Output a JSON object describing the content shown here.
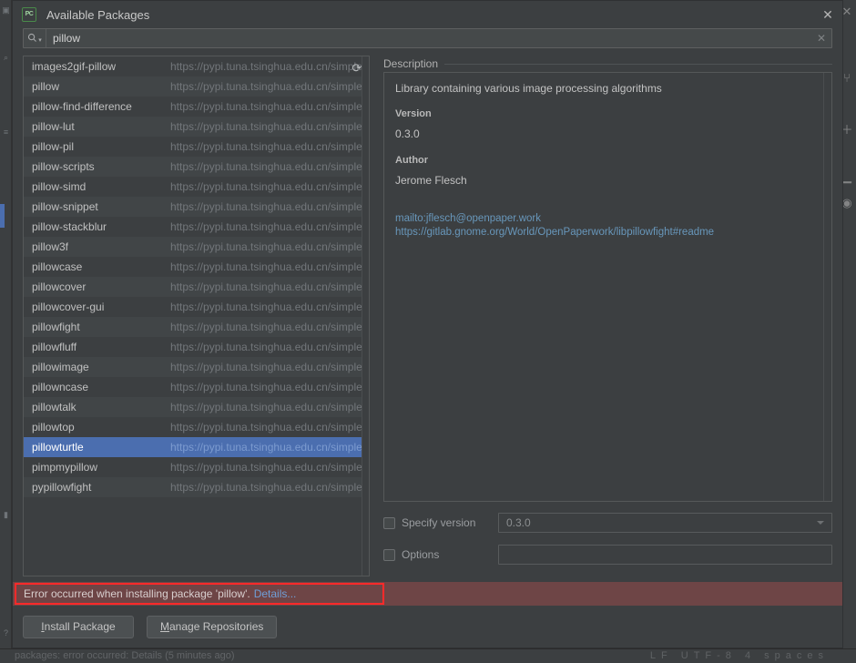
{
  "window": {
    "title": "Available Packages",
    "app_icon": "PC",
    "close_icon": "✕"
  },
  "search": {
    "icon": "search-icon",
    "value": "pillow",
    "placeholder": "",
    "clear_icon": "✕"
  },
  "package_list": {
    "refresh_icon": "⟳",
    "repo_url": "https://pypi.tuna.tsinghua.edu.cn/simple/",
    "selected_index": 19,
    "items": [
      {
        "name": "images2gif-pillow",
        "url": "https://pypi.tuna.tsinghua.edu.cn/simple/"
      },
      {
        "name": "pillow",
        "url": "https://pypi.tuna.tsinghua.edu.cn/simple/"
      },
      {
        "name": "pillow-find-difference",
        "url": "https://pypi.tuna.tsinghua.edu.cn/simple/"
      },
      {
        "name": "pillow-lut",
        "url": "https://pypi.tuna.tsinghua.edu.cn/simple/"
      },
      {
        "name": "pillow-pil",
        "url": "https://pypi.tuna.tsinghua.edu.cn/simple/"
      },
      {
        "name": "pillow-scripts",
        "url": "https://pypi.tuna.tsinghua.edu.cn/simple/"
      },
      {
        "name": "pillow-simd",
        "url": "https://pypi.tuna.tsinghua.edu.cn/simple/"
      },
      {
        "name": "pillow-snippet",
        "url": "https://pypi.tuna.tsinghua.edu.cn/simple/"
      },
      {
        "name": "pillow-stackblur",
        "url": "https://pypi.tuna.tsinghua.edu.cn/simple/"
      },
      {
        "name": "pillow3f",
        "url": "https://pypi.tuna.tsinghua.edu.cn/simple/"
      },
      {
        "name": "pillowcase",
        "url": "https://pypi.tuna.tsinghua.edu.cn/simple/"
      },
      {
        "name": "pillowcover",
        "url": "https://pypi.tuna.tsinghua.edu.cn/simple/"
      },
      {
        "name": "pillowcover-gui",
        "url": "https://pypi.tuna.tsinghua.edu.cn/simple/"
      },
      {
        "name": "pillowfight",
        "url": "https://pypi.tuna.tsinghua.edu.cn/simple/"
      },
      {
        "name": "pillowfluff",
        "url": "https://pypi.tuna.tsinghua.edu.cn/simple/"
      },
      {
        "name": "pillowimage",
        "url": "https://pypi.tuna.tsinghua.edu.cn/simple/"
      },
      {
        "name": "pillowncase",
        "url": "https://pypi.tuna.tsinghua.edu.cn/simple/"
      },
      {
        "name": "pillowtalk",
        "url": "https://pypi.tuna.tsinghua.edu.cn/simple/"
      },
      {
        "name": "pillowtop",
        "url": "https://pypi.tuna.tsinghua.edu.cn/simple/"
      },
      {
        "name": "pillowturtle",
        "url": "https://pypi.tuna.tsinghua.edu.cn/simple/"
      },
      {
        "name": "pimpmypillow",
        "url": "https://pypi.tuna.tsinghua.edu.cn/simple/"
      },
      {
        "name": "pypillowfight",
        "url": "https://pypi.tuna.tsinghua.edu.cn/simple/"
      }
    ]
  },
  "description": {
    "legend": "Description",
    "summary": "Library containing various image processing algorithms",
    "version_label": "Version",
    "version_value": "0.3.0",
    "author_label": "Author",
    "author_value": "Jerome Flesch",
    "links": [
      "mailto:jflesch@openpaper.work",
      "https://gitlab.gnome.org/World/OpenPaperwork/libpillowfight#readme"
    ]
  },
  "options": {
    "specify_version_label": "Specify version",
    "specify_version_value": "0.3.0",
    "specify_version_checked": false,
    "options_label": "Options",
    "options_value": "",
    "options_checked": false,
    "dropdown_icon": "chevron-down-icon"
  },
  "error": {
    "message": "Error occurred when installing package 'pillow'.",
    "details_link": "Details...",
    "highlight_color": "#ff2a2a",
    "bar_color": "#6e4546"
  },
  "footer": {
    "install_mnemonic": "I",
    "install_rest": "nstall Package",
    "manage_mnemonic": "M",
    "manage_rest": "anage Repositories"
  },
  "ide": {
    "status_text": "packages: error occurred: Details (5 minutes ago)",
    "status_right": "LF    UTF-8    4 spaces",
    "right_icons": [
      "close-icon",
      "branch-icon",
      "plus-icon",
      "eye-icon"
    ],
    "left_icons": [
      "project-icon",
      "search-icon",
      "structure-icon",
      "bookmark-icon",
      "commit-icon",
      "help-icon"
    ]
  },
  "colors": {
    "accent_selection": "#4b6eaf",
    "link": "#6897bb",
    "error_border": "#ff2a2a",
    "background": "#3c3f41"
  }
}
